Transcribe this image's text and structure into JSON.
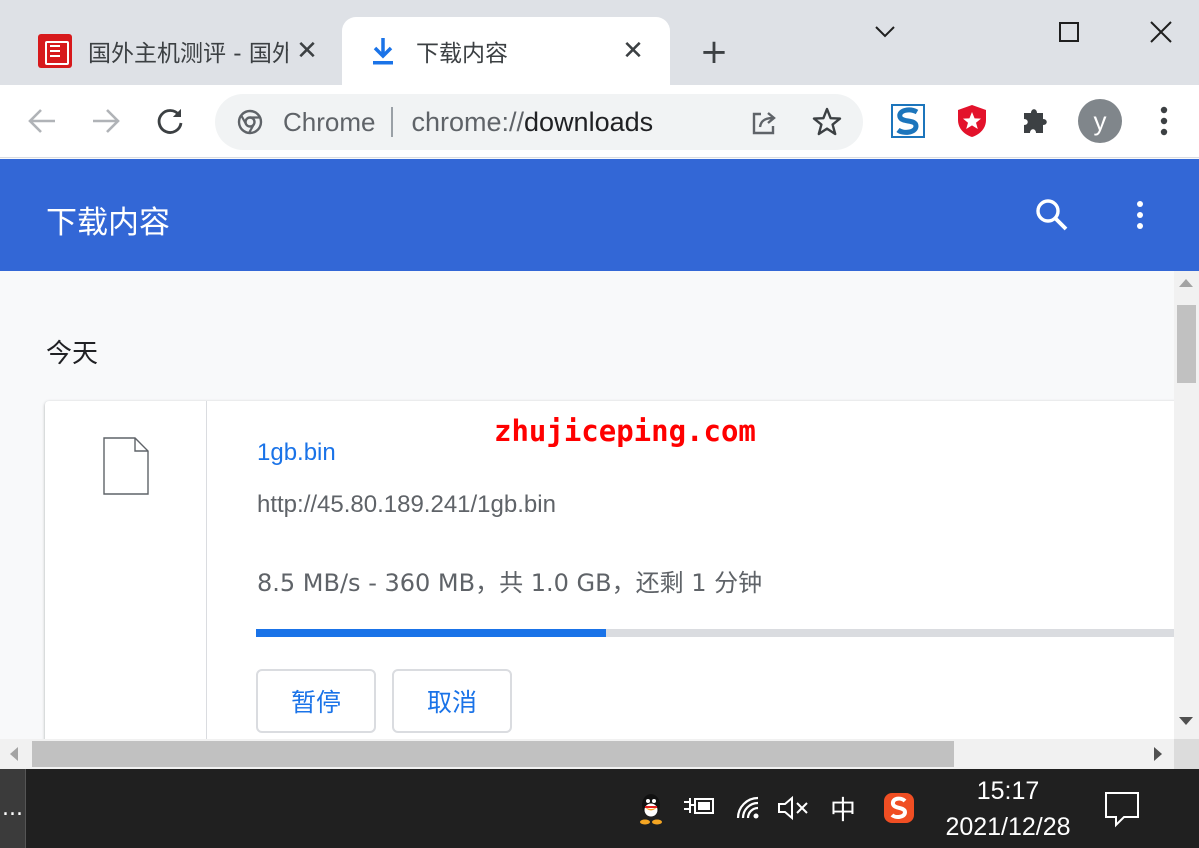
{
  "tabs": [
    {
      "title": "国外主机测评 - 国外",
      "close": "✕"
    },
    {
      "title": "下载内容",
      "close": "✕"
    }
  ],
  "new_tab_label": "+",
  "omnibox": {
    "scheme_label": "Chrome",
    "url_prefix": "chrome://",
    "url_host": "downloads"
  },
  "profile": {
    "initial": "y"
  },
  "page": {
    "header_title": "下载内容",
    "section_label": "今天",
    "watermark": "zhujiceping.com"
  },
  "download": {
    "file_name": "1gb.bin",
    "url": "http://45.80.189.241/1gb.bin",
    "status": "8.5 MB/s - 360 MB，共 1.0 GB，还剩 1 分钟",
    "progress_fraction": 0.38,
    "pause_label": "暂停",
    "cancel_label": "取消"
  },
  "taskbar": {
    "start_label": "...",
    "ime_label": "中",
    "time": "15:17",
    "date": "2021/12/28"
  },
  "colors": {
    "header_blue": "#3367d6",
    "link_blue": "#1a73e8",
    "watermark_red": "#ff0000"
  },
  "icons": [
    "chevron-down-icon",
    "maximize-icon",
    "close-icon",
    "back-arrow-icon",
    "forward-arrow-icon",
    "reload-icon",
    "chrome-logo-icon",
    "share-icon",
    "star-icon",
    "s-extension-icon",
    "shield-extension-icon",
    "puzzle-icon",
    "menu-dots-icon",
    "search-icon",
    "file-icon",
    "qq-icon",
    "power-icon",
    "wifi-icon",
    "volume-muted-icon",
    "sogou-icon",
    "notification-icon"
  ]
}
